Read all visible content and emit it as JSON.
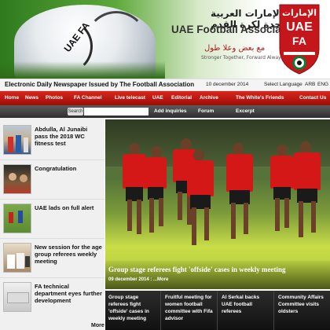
{
  "banner": {
    "ball_text": "UAE FA",
    "assoc_name_ar": "اتحاد الإمارات العربية المتحدة لكرة القدم",
    "assoc_name_en": "UAE Football Association",
    "slogan_ar": "مع بعض وعلا طول",
    "slogan_sub": "Stronger Together, Forward Always",
    "crest_ar": "الإمارات",
    "crest_en_1": "UAE",
    "crest_en_2": "FA"
  },
  "topbar": {
    "tagline": "Electronic Daily Newspaper Issued by The Football Association",
    "date": "10 december 2014",
    "language_label": "Select Language",
    "lang_arb": "ARB",
    "lang_eng": "ENG"
  },
  "nav": {
    "items": [
      "Home",
      "News",
      "Photos",
      "FA Channel",
      "Live telecast",
      "UAE",
      "Editorial",
      "Archive",
      "The White's Friends",
      "Contact Us"
    ]
  },
  "searchbar": {
    "label": "Search",
    "placeholder": "",
    "links": [
      "Add inquiries",
      "Forum",
      "Excerpt"
    ]
  },
  "news": {
    "items": [
      {
        "title": "Abdulla, Al Junaibi pass the 2018 WC fitness test"
      },
      {
        "title": "Congratulation"
      },
      {
        "title": "UAE lads on full alert"
      },
      {
        "title": "New session for the age group referees weekly meeting"
      },
      {
        "title": "FA technical department eyes further development"
      }
    ],
    "more": "More"
  },
  "featured": {
    "title": "Group stage referees fight 'offside' cases in weekly meeting",
    "date": "09 december 2014 : ...More"
  },
  "tabs": {
    "items": [
      "Group stage referees fight 'offside' cases in weekly meeting",
      "Fruitful meeting for women football committee with Fifa advisor",
      "Al Serkal backs UAE football referees",
      "Community Affairs Committee visits oldsters"
    ]
  },
  "colors": {
    "nav_red": "#c4181b",
    "tab_dark": "#1f1f1f",
    "search_dark": "#3c3c3c"
  }
}
